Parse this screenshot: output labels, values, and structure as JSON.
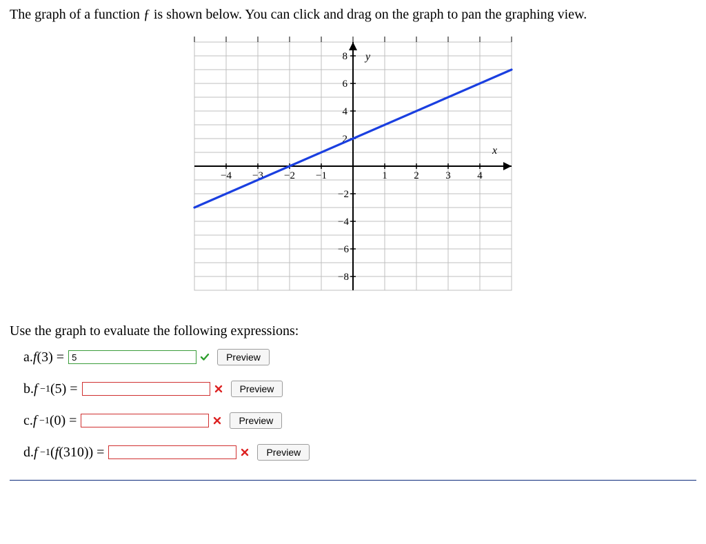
{
  "prompt1": "The graph of a function ƒ is shown below. You can click and drag on the graph to pan the graphing view.",
  "prompt2": "Use the graph to evaluate the following expressions:",
  "preview_label": "Preview",
  "questions": {
    "a": {
      "letter": "a.",
      "expr_html": "<span class='fnf'>f</span>(3) = ",
      "value": "5",
      "status": "correct",
      "input_width": 186
    },
    "b": {
      "letter": "b.",
      "expr_html": "<span class='fnf'>f</span><span class='sup'>&nbsp;&minus;1</span>(5) = ",
      "value": "",
      "status": "incorrect",
      "input_width": 186
    },
    "c": {
      "letter": "c.",
      "expr_html": "<span class='fnf'>f</span><span class='sup'>&nbsp;&minus;1</span>(0) = ",
      "value": "",
      "status": "incorrect",
      "input_width": 186
    },
    "d": {
      "letter": "d.",
      "expr_html": "<span class='fnf'>f</span><span class='sup'>&nbsp;&minus;1</span>(<span class='fnf'>f</span>(310)) = ",
      "value": "",
      "status": "incorrect",
      "input_width": 186
    }
  },
  "chart_data": {
    "type": "line",
    "title": "",
    "xlabel": "x",
    "ylabel": "y",
    "xlim": [
      -5,
      5
    ],
    "ylim": [
      -9,
      9
    ],
    "x_ticks": [
      -4,
      -3,
      -2,
      -1,
      1,
      2,
      3,
      4
    ],
    "y_ticks_pos": [
      2,
      4,
      6,
      8
    ],
    "y_ticks_neg": [
      -2,
      -4,
      -6,
      -8
    ],
    "series": [
      {
        "name": "f",
        "color": "#1a3fe0",
        "x": [
          -5,
          5
        ],
        "y": [
          -3,
          7
        ]
      }
    ],
    "grid": true
  }
}
